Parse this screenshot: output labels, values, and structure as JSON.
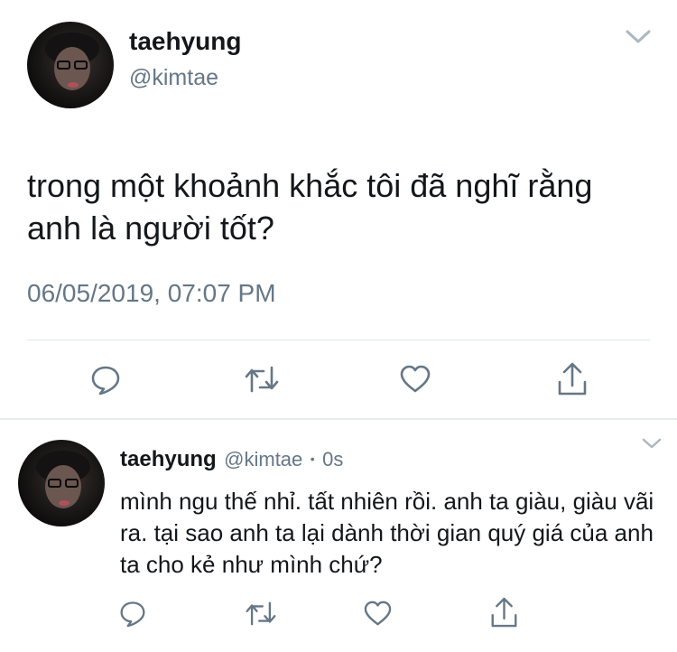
{
  "main_tweet": {
    "display_name": "taehyung",
    "handle": "@kimtae",
    "text": "trong một khoảnh khắc tôi đã nghĩ rằng anh là người tốt?",
    "timestamp": "06/05/2019, 07:07 PM"
  },
  "reply_tweet": {
    "display_name": "taehyung",
    "handle": "@kimtae",
    "separator": "•",
    "time": "0s",
    "text": "mình ngu thế nhỉ. tất nhiên rồi. anh ta giàu, giàu vãi ra. tại sao anh ta lại dành thời gian quý giá của anh ta cho kẻ như mình chứ?"
  },
  "icons": {
    "reply": "speech-bubble",
    "retweet": "retweet-arrows",
    "like": "heart-outline",
    "share": "share-upload",
    "menu": "chevron-down"
  },
  "colors": {
    "icon": "#657786",
    "text": "#14171a",
    "divider": "#e1e8ed"
  }
}
